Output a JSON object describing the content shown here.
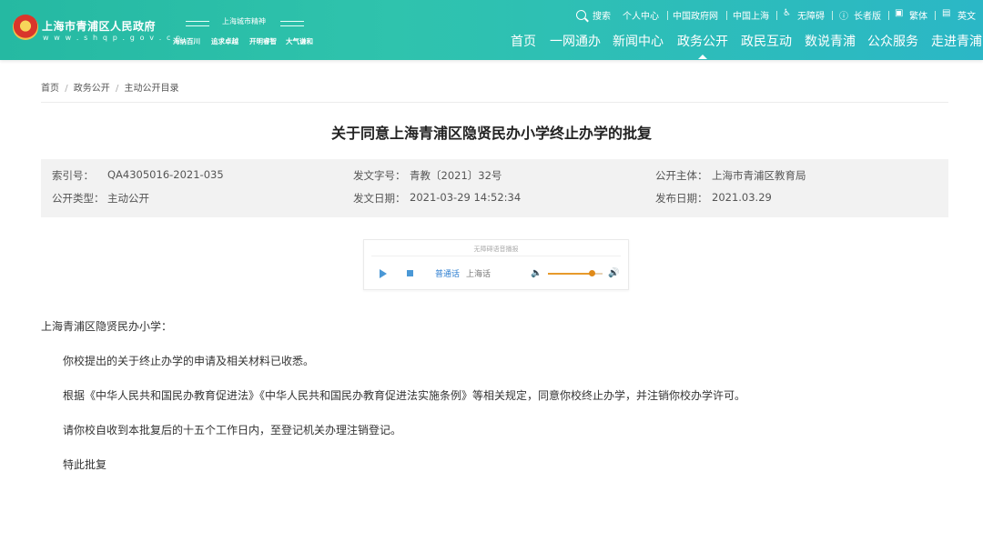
{
  "header": {
    "site_name": "上海市青浦区人民政府",
    "site_url": "w w w . s h q p . g o v . c n",
    "spirit_title": "上海城市精神",
    "spirit_words": [
      "海纳百川",
      "追求卓越",
      "开明睿智",
      "大气谦和"
    ],
    "top_links": [
      "搜索",
      "个人中心",
      "中国政府网",
      "中国上海",
      "无障碍",
      "长者版",
      "繁体",
      "英文"
    ],
    "nav": [
      "首页",
      "一网通办",
      "新闻中心",
      "政务公开",
      "政民互动",
      "数说青浦",
      "公众服务",
      "走进青浦"
    ],
    "active_nav": "政务公开"
  },
  "breadcrumb": [
    "首页",
    "/",
    "政务公开",
    "/",
    "主动公开目录"
  ],
  "article": {
    "title": "关于同意上海青浦区隐贤民办小学终止办学的批复",
    "meta": {
      "index_label": "索引号：",
      "index_value": "QA4305016-2021-035",
      "doc_no_label": "发文字号：",
      "doc_no_value": "青教〔2021〕32号",
      "publisher_label": "公开主体：",
      "publisher_value": "上海市青浦区教育局",
      "type_label": "公开类型：",
      "type_value": "主动公开",
      "issue_date_label": "发文日期：",
      "issue_date_value": "2021-03-29 14:52:34",
      "publish_date_label": "发布日期：",
      "publish_date_value": "2021.03.29"
    },
    "audio": {
      "title": "无障碍语音播报",
      "mandarin": "普通话",
      "shanghainese": "上海话",
      "volume": 0.8
    },
    "salutation": "上海青浦区隐贤民办小学：",
    "paragraphs": [
      "你校提出的关于终止办学的申请及相关材料已收悉。",
      "根据《中华人民共和国民办教育促进法》《中华人民共和国民办教育促进法实施条例》等相关规定，同意你校终止办学，并注销你校办学许可。",
      "请你校自收到本批复后的十五个工作日内，至登记机关办理注销登记。",
      "特此批复"
    ]
  },
  "colors": {
    "header_gradient_start": "#25b9a2",
    "header_gradient_end": "#2bb7c6",
    "audio_accent": "#4a98d6",
    "volume_accent": "#e08a18"
  }
}
